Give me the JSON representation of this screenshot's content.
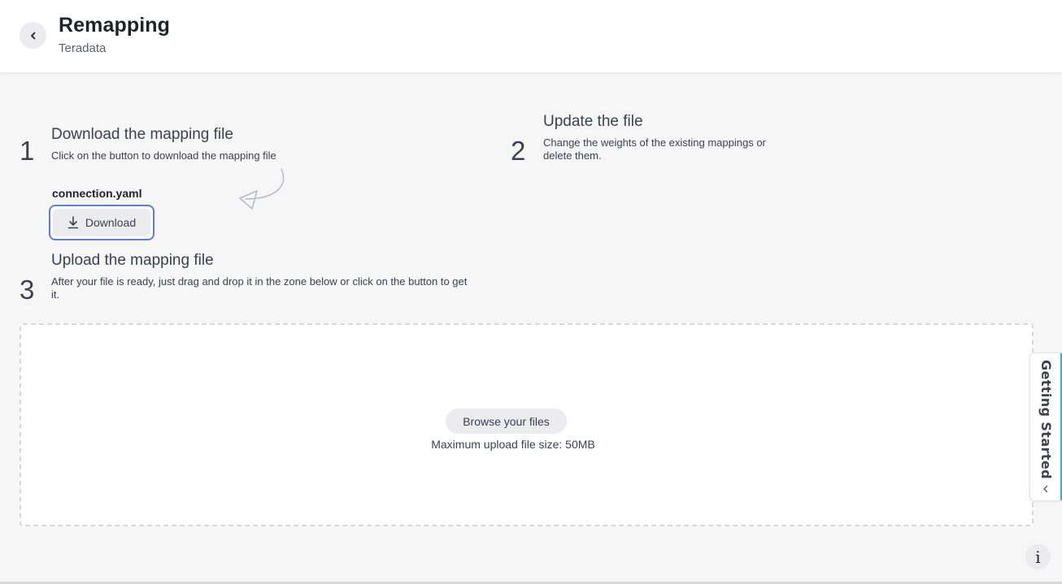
{
  "header": {
    "title": "Remapping",
    "subtitle": "Teradata"
  },
  "steps": [
    {
      "number": "1",
      "title": "Download the mapping file",
      "description": "Click on the button to download the mapping file"
    },
    {
      "number": "2",
      "title": "Update the file",
      "description": "Change the weights of the existing mappings or delete them."
    },
    {
      "number": "3",
      "title": "Upload the mapping file",
      "description": "After your file is ready, just drag and drop it in the zone below or click on the button to get it."
    }
  ],
  "download": {
    "filename": "connection.yaml",
    "button_label": "Download"
  },
  "upload": {
    "browse_label": "Browse your files",
    "max_size_text": "Maximum upload file size: 50MB"
  },
  "getting_started": {
    "label": "Getting Started"
  },
  "info": {
    "glyph": "i"
  },
  "colors": {
    "accent_focus": "#5f7be0",
    "tab_accent": "#3aa8d8"
  }
}
